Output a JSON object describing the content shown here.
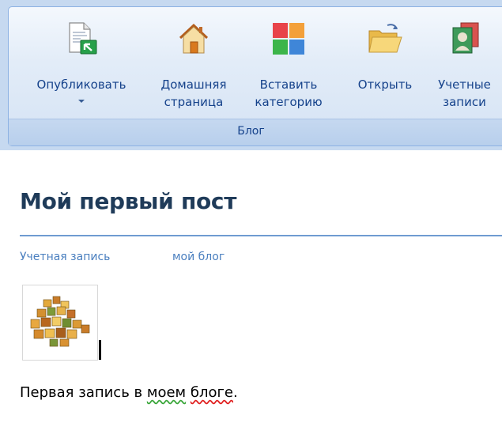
{
  "ribbon": {
    "buttons": [
      {
        "line1": "Опубликовать",
        "line2": "",
        "icon": "publish-icon",
        "has_dropdown": true
      },
      {
        "line1": "Домашняя",
        "line2": "страница",
        "icon": "home-icon"
      },
      {
        "line1": "Вставить",
        "line2": "категорию",
        "icon": "categories-icon"
      },
      {
        "line1": "Открыть",
        "line2": "",
        "icon": "open-folder-icon"
      },
      {
        "line1": "Учетные",
        "line2": "записи",
        "icon": "accounts-icon"
      }
    ],
    "group_label": "Блог",
    "colors": {
      "accent": "#15428b",
      "ribbon_bg": "#c6d9f0"
    }
  },
  "post": {
    "title": "Мой первый пост",
    "meta": {
      "account_label": "Учетная запись",
      "blog_name": "мой блог"
    },
    "image_icon": "food-cubes-image",
    "body": {
      "part1": "Первая запись в ",
      "word1": "моем",
      "space": " ",
      "word2": "блоге",
      "end": "."
    }
  }
}
